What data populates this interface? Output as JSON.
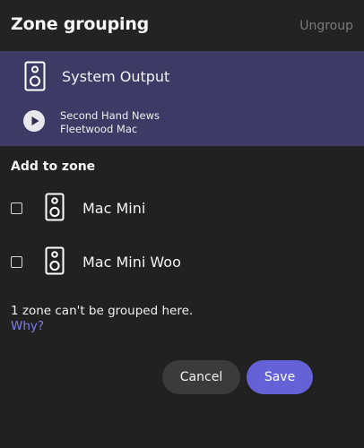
{
  "header": {
    "title": "Zone grouping",
    "ungroup_label": "Ungroup"
  },
  "current_zone": {
    "name": "System Output",
    "icon": "speaker-icon",
    "now_playing": {
      "title": "Second Hand News",
      "artist": "Fleetwood Mac",
      "play_icon": "play-icon"
    }
  },
  "add_to_zone": {
    "heading": "Add to zone",
    "zones": [
      {
        "name": "Mac Mini",
        "checked": false,
        "icon": "speaker-icon"
      },
      {
        "name": "Mac Mini Woo",
        "checked": false,
        "icon": "speaker-icon"
      }
    ]
  },
  "notice": {
    "text": "1 zone can't be grouped here.",
    "link": "Why?"
  },
  "actions": {
    "cancel_label": "Cancel",
    "save_label": "Save"
  },
  "colors": {
    "background": "#212121",
    "zone_card": "#3d3b66",
    "accent": "#6462d6",
    "link": "#7d7df0",
    "cancel_button": "#3b3b3b"
  }
}
